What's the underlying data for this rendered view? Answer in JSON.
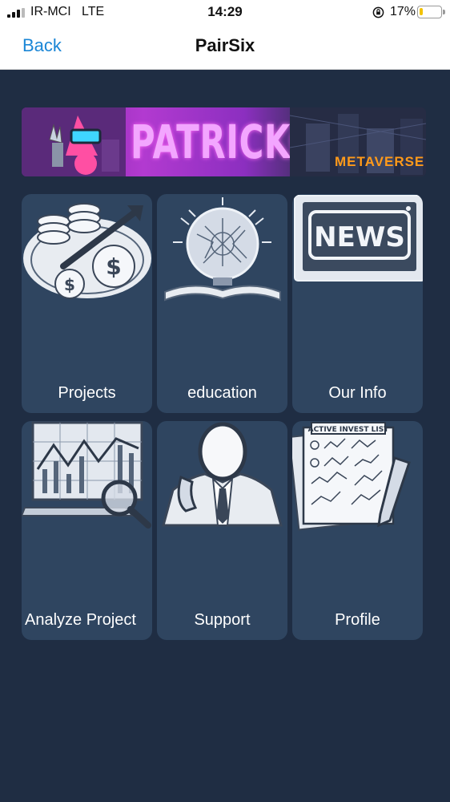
{
  "status_bar": {
    "carrier": "IR-MCI",
    "network": "LTE",
    "time": "14:29",
    "battery_percent": "17%",
    "battery_level": 0.17,
    "battery_color": "#f2c200"
  },
  "nav": {
    "back_label": "Back",
    "title": "PairSix"
  },
  "banner": {
    "brand": "PATRICKO",
    "sub": "METAVERSE"
  },
  "tiles": [
    {
      "label": "Projects",
      "icon": "coins-growth-icon"
    },
    {
      "label": "education",
      "icon": "lightbulb-book-icon"
    },
    {
      "label": "Our Info",
      "icon": "news-sign-icon"
    },
    {
      "label": "Analyze Project",
      "icon": "chart-magnifier-icon"
    },
    {
      "label": "Support",
      "icon": "support-agent-icon"
    },
    {
      "label": "Profile",
      "icon": "invest-list-icon"
    }
  ],
  "tile_art": {
    "invest_list_title": "ACTIVE INVEST LIST",
    "news_text": "NEWS"
  },
  "colors": {
    "background": "#1f2d43",
    "tile": "#2f4560",
    "accent": "#1a86d6"
  }
}
